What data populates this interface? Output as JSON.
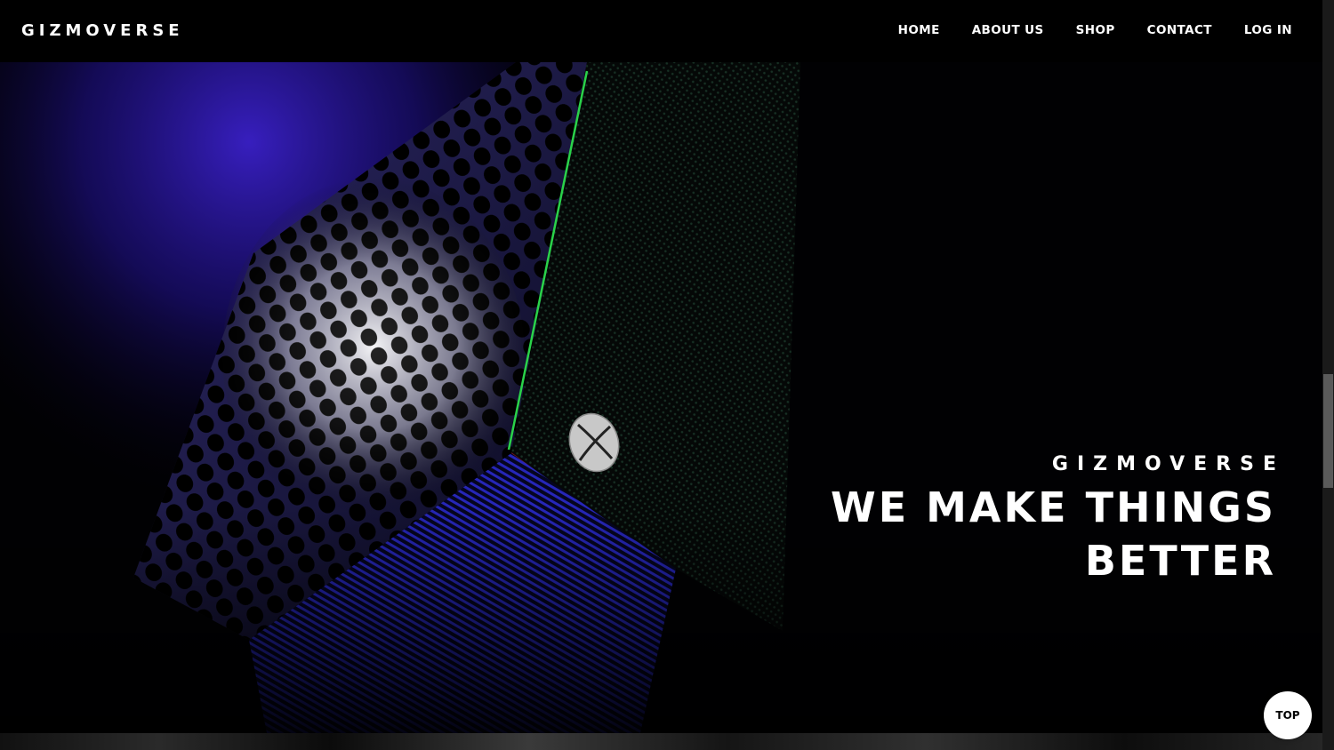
{
  "header": {
    "logo": "GIZMOVERSE",
    "nav": [
      "HOME",
      "ABOUT US",
      "SHOP",
      "CONTACT",
      "LOG IN"
    ]
  },
  "hero": {
    "brand": "GIZMOVERSE",
    "headline": "WE MAKE THINGS BETTER",
    "image": "xbox-console-closeup"
  },
  "top_button": "TOP",
  "colors": {
    "background": "#000000",
    "text": "#ffffff",
    "accent_blue": "#2a1aa8",
    "accent_green": "#22c040"
  }
}
